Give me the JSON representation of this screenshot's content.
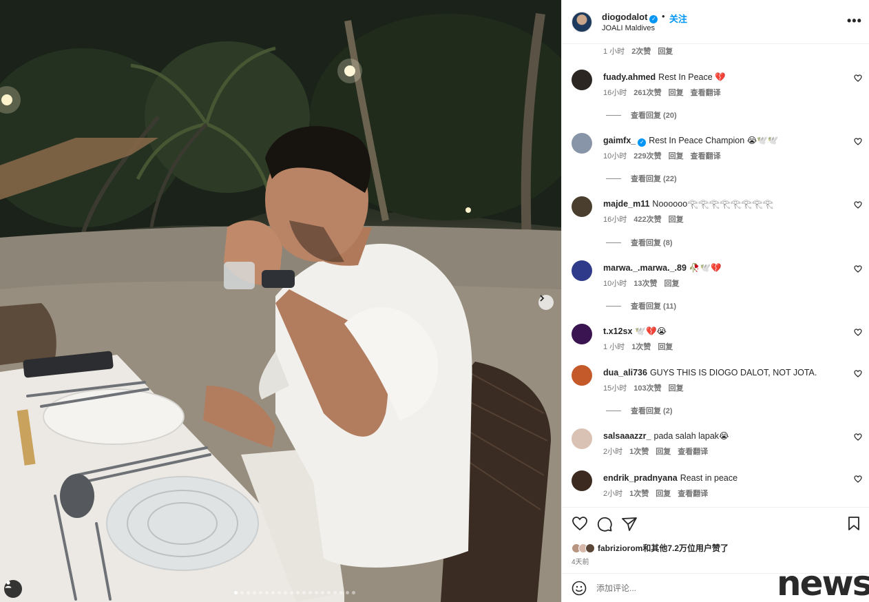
{
  "post": {
    "username": "diogodalot",
    "follow_label": "关注",
    "separator": "•",
    "location": "JOALI Maldives",
    "carousel_total": 20,
    "carousel_active": 1
  },
  "top_meta": {
    "time": "1 小时",
    "likes": "2次赞",
    "reply": "回复"
  },
  "comments": [
    {
      "user": "fuady.ahmed",
      "verified": false,
      "text": "Rest In Peace 💔",
      "time": "16小时",
      "likes": "261次赞",
      "reply": "回复",
      "translate": "查看翻译",
      "replies": "查看回复 (20)",
      "avatar": "#2b2622"
    },
    {
      "user": "gaimfx_",
      "verified": true,
      "text": "Rest In Peace Champion 😭🕊️🕊️",
      "time": "10小时",
      "likes": "229次赞",
      "reply": "回复",
      "translate": "查看翻译",
      "replies": "查看回复 (22)",
      "avatar": "#8895a8"
    },
    {
      "user": "majde_m11",
      "verified": false,
      "text": "Noooooo𓂀𓂀𓂀𓂀𓂀𓂀𓂀𓂀",
      "time": "16小时",
      "likes": "422次赞",
      "reply": "回复",
      "translate": "",
      "replies": "查看回复 (8)",
      "avatar": "#4a3f2e"
    },
    {
      "user": "marwa._.marwa._.89",
      "verified": false,
      "text": "🥀🕊️💔",
      "time": "10小时",
      "likes": "13次赞",
      "reply": "回复",
      "translate": "",
      "replies": "查看回复 (11)",
      "avatar": "#2f3a8a"
    },
    {
      "user": "t.x12sx",
      "verified": false,
      "text": "🕊️💔😭",
      "time": "1 小时",
      "likes": "1次赞",
      "reply": "回复",
      "translate": "",
      "replies": "",
      "avatar": "#3a1450"
    },
    {
      "user": "dua_ali736",
      "verified": false,
      "text": "GUYS THIS IS DIOGO DALOT, NOT JOTA.",
      "time": "15小时",
      "likes": "103次赞",
      "reply": "回复",
      "translate": "",
      "replies": "查看回复 (2)",
      "avatar": "#c45a2a"
    },
    {
      "user": "salsaaazzr_",
      "verified": false,
      "text": "pada salah lapak😭",
      "time": "2小时",
      "likes": "1次赞",
      "reply": "回复",
      "translate": "查看翻译",
      "replies": "",
      "avatar": "#d9c2b4"
    },
    {
      "user": "endrik_pradnyana",
      "verified": false,
      "text": "Reast in peace",
      "time": "2小时",
      "likes": "1次赞",
      "reply": "回复",
      "translate": "查看翻译",
      "replies": "",
      "avatar": "#3c2a20"
    }
  ],
  "likes_text": "fabriziorom和其他7.2万位用户赞了",
  "post_date": "4天前",
  "comment_placeholder": "添加评论...",
  "watermark": "news",
  "colors": {
    "link_blue": "#0095f6",
    "heart_red": "#e0245e",
    "muted": "#737373"
  }
}
